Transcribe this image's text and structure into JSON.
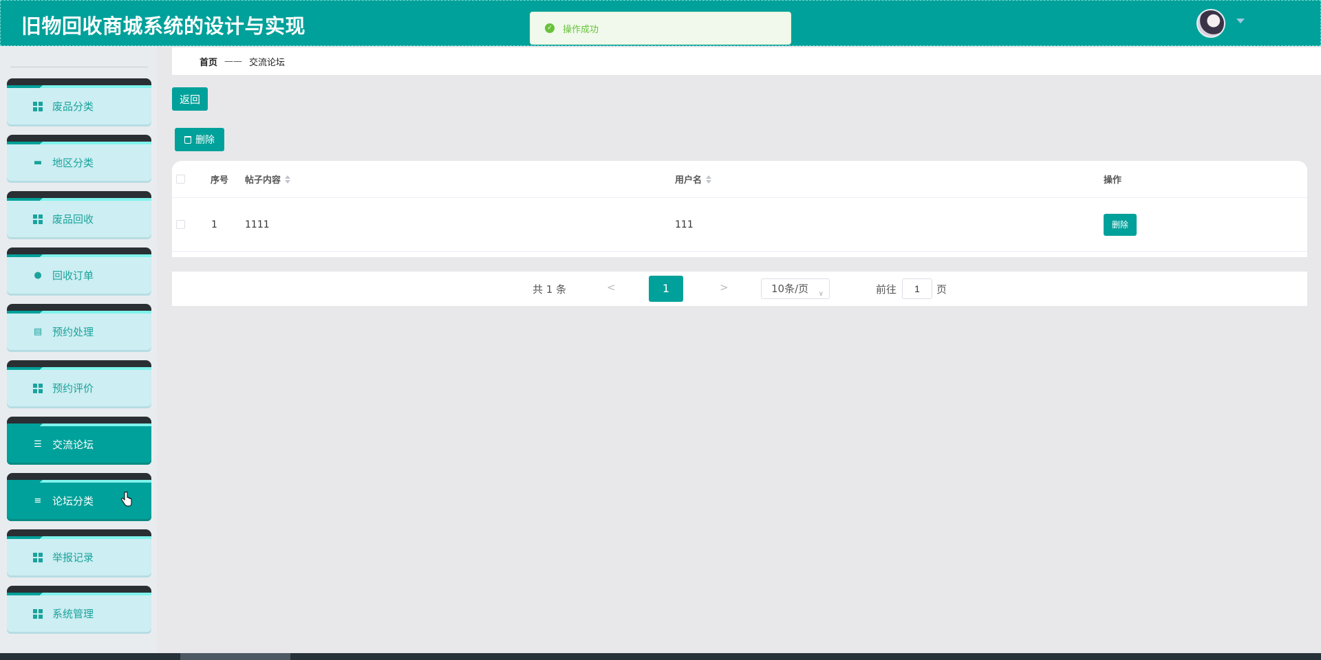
{
  "header": {
    "title": "旧物回收商城系统的设计与实现"
  },
  "toast": {
    "message": "操作成功",
    "icon": "check-circle-icon",
    "color": "#67c23a"
  },
  "sidebar": {
    "items": [
      {
        "label": "废品分类",
        "icon": "grid-icon",
        "active": false
      },
      {
        "label": "地区分类",
        "icon": "paint-roller-icon",
        "active": false
      },
      {
        "label": "废品回收",
        "icon": "grid-icon",
        "active": false
      },
      {
        "label": "回收订单",
        "icon": "user-icon",
        "active": false
      },
      {
        "label": "预约处理",
        "icon": "clipboard-icon",
        "active": false
      },
      {
        "label": "预约评价",
        "icon": "grid-icon",
        "active": false
      },
      {
        "label": "交流论坛",
        "icon": "sliders-icon",
        "active": true
      },
      {
        "label": "论坛分类",
        "icon": "list-icon",
        "active": true
      },
      {
        "label": "举报记录",
        "icon": "grid-icon",
        "active": false
      },
      {
        "label": "系统管理",
        "icon": "grid-icon",
        "active": false
      }
    ]
  },
  "breadcrumb": {
    "home": "首页",
    "separator": "——",
    "current": "交流论坛"
  },
  "toolbar": {
    "back_label": "返回",
    "delete_label": "删除"
  },
  "table": {
    "columns": [
      "序号",
      "帖子内容",
      "用户名",
      "操作"
    ],
    "rows": [
      {
        "index": "1",
        "content": "1111",
        "username": "111",
        "action": "删除"
      }
    ]
  },
  "pagination": {
    "total": "共 1 条",
    "prev": "<",
    "current_page": "1",
    "next": ">",
    "page_size": "10条/页",
    "goto_label": "前往",
    "goto_value": "1",
    "goto_unit": "页"
  },
  "colors": {
    "primary": "#00a19a",
    "menu_bg": "#cdeef2",
    "success": "#67c23a"
  }
}
